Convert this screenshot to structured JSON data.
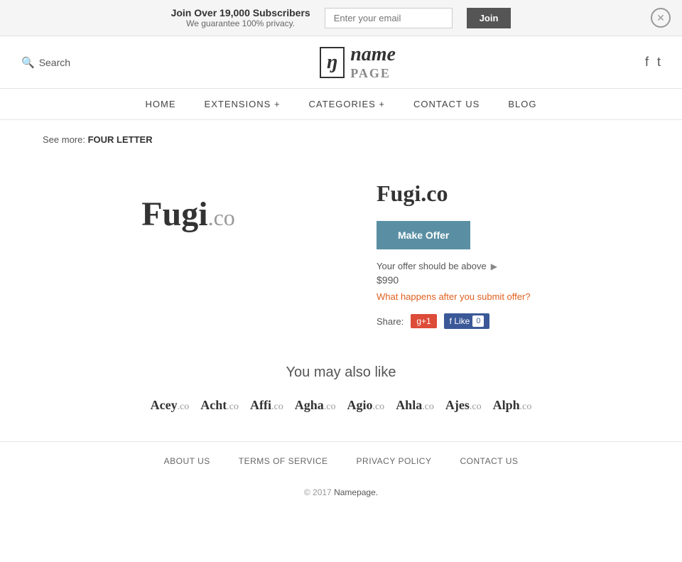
{
  "banner": {
    "main_text": "Join Over 19,000 Subscribers",
    "sub_text": "We guarantee 100% privacy.",
    "email_placeholder": "Enter your email",
    "join_label": "Join"
  },
  "header": {
    "search_label": "Search",
    "logo_n": "n",
    "logo_name": "name",
    "logo_page": "PAGE"
  },
  "nav": {
    "items": [
      {
        "label": "HOME"
      },
      {
        "label": "EXTENSIONS +"
      },
      {
        "label": "CATEGORIES +"
      },
      {
        "label": "CONTACT US"
      },
      {
        "label": "BLOG"
      }
    ]
  },
  "breadcrumb": {
    "see_more_label": "See more:",
    "see_more_value": "FOUR LETTER"
  },
  "domain": {
    "name": "Fugi.co",
    "logo_main": "Fugi",
    "logo_ext": ".co",
    "make_offer_label": "Make Offer",
    "offer_hint": "Your offer should be above",
    "offer_amount": "$990",
    "offer_link": "What happens after you submit offer?",
    "share_label": "Share:",
    "gplus_label": "g+1",
    "fb_label": "f Like",
    "fb_count": "0"
  },
  "may_also_like": {
    "title": "You may also like",
    "domains": [
      {
        "name": "Acey",
        "ext": ".co"
      },
      {
        "name": "Acht",
        "ext": ".co"
      },
      {
        "name": "Affi",
        "ext": ".co"
      },
      {
        "name": "Agha",
        "ext": ".co"
      },
      {
        "name": "Agio",
        "ext": ".co"
      },
      {
        "name": "Ahla",
        "ext": ".co"
      },
      {
        "name": "Ajes",
        "ext": ".co"
      },
      {
        "name": "Alph",
        "ext": ".co"
      }
    ]
  },
  "footer": {
    "links": [
      {
        "label": "ABOUT US"
      },
      {
        "label": "TERMS OF SERVICE"
      },
      {
        "label": "PRIVACY POLICY"
      },
      {
        "label": "CONTACT US"
      }
    ],
    "copy": "© 2017",
    "brand": "Namepage."
  }
}
